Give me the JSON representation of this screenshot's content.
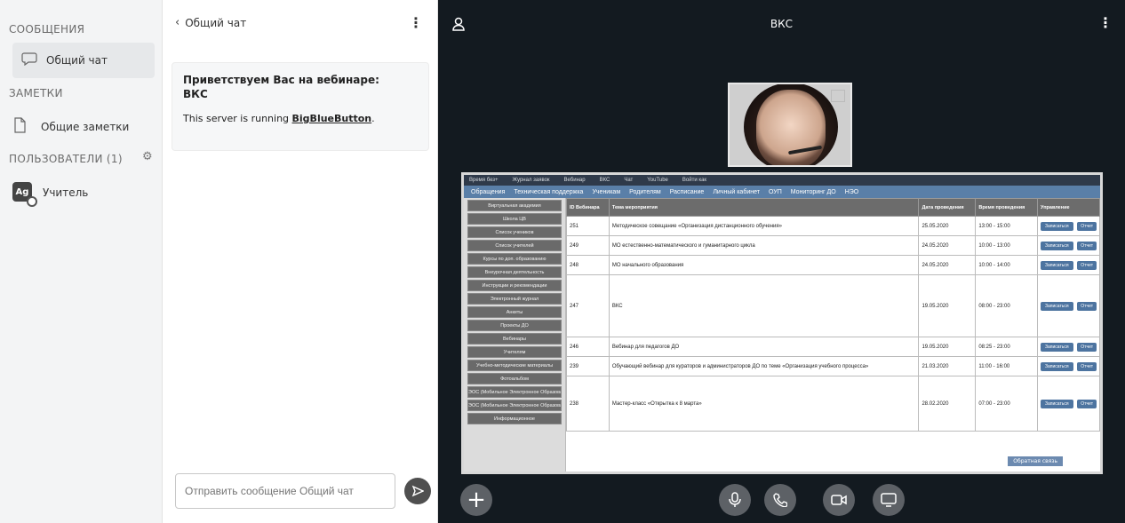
{
  "userlist": {
    "messages_title": "СООБЩЕНИЯ",
    "chat_item": "Общий чат",
    "notes_title": "ЗАМЕТКИ",
    "notes_item": "Общие заметки",
    "users_title": "ПОЛЬЗОВАТЕЛИ (1)",
    "user_initials": "Ag",
    "user_name": "Учитель"
  },
  "chat": {
    "title": "Общий чат",
    "welcome_line1": "Приветствуем Вас на вебинаре:",
    "welcome_line2": "ВКС",
    "server_text": "This server is running",
    "server_link": "BigBlueButton",
    "server_suffix": ".",
    "input_placeholder": "Отправить сообщение Общий чат"
  },
  "main": {
    "title": "ВКС"
  },
  "slide": {
    "topbar": [
      "Время без+",
      "Журнал заявок",
      "Вебинар",
      "ВКС",
      "Чат",
      "YouTube",
      "Войти как"
    ],
    "navbar": [
      "Обращения",
      "Техническая поддержка",
      "Ученикам",
      "Родителям",
      "Расписание",
      "Личный кабинет",
      "ОУП",
      "Мониторинг ДО",
      "НЭО"
    ],
    "sidebar": [
      "Виртуальная академия",
      "Школа ЦВ",
      "Список учеников",
      "Список учителей",
      "Курсы по доп. образованию",
      "Внеурочная деятельность",
      "Инструкции и рекомендации",
      "Электронный журнал",
      "Анкеты",
      "Проекты ДО",
      "Вебинары",
      "Учителям",
      "Учебно-методические материалы",
      "Фотоальбом",
      "ЭОС (Мобильное Электронное Образование)",
      "ЭОС (Мобильное Электронное Образование)",
      "Информационное"
    ],
    "headers": [
      "ID Вебинара",
      "Тема мероприятия",
      "Дата проведения",
      "Время проведения",
      "Управление"
    ],
    "rows": [
      {
        "id": "251",
        "topic": "Методическое совещание «Организация дистанционного обучения»",
        "date": "25.05.2020",
        "time": "13:00 - 15:00"
      },
      {
        "id": "249",
        "topic": "МО естественно-математического и гуманитарного цикла",
        "date": "24.05.2020",
        "time": "10:00 - 13:00"
      },
      {
        "id": "248",
        "topic": "МО начального образования",
        "date": "24.05.2020",
        "time": "10:00 - 14:00"
      },
      {
        "id": "247",
        "topic": "ВКС",
        "date": "19.05.2020",
        "time": "08:00 - 23:00"
      },
      {
        "id": "246",
        "topic": "Вебинар для педагогов ДО",
        "date": "19.05.2020",
        "time": "08:25 - 23:00"
      },
      {
        "id": "239",
        "topic": "Обучающий вебинар для кураторов и администраторов ДО по теме «Организация учебного процесса»",
        "date": "21.03.2020",
        "time": "11:00 - 16:00"
      },
      {
        "id": "238",
        "topic": "Мастер-класс «Открытка к 8 марта»",
        "date": "28.02.2020",
        "time": "07:00 - 23:00"
      }
    ],
    "join_label": "Записаться",
    "report_label": "Отчет",
    "dropdown_label": "Обратная связь"
  }
}
